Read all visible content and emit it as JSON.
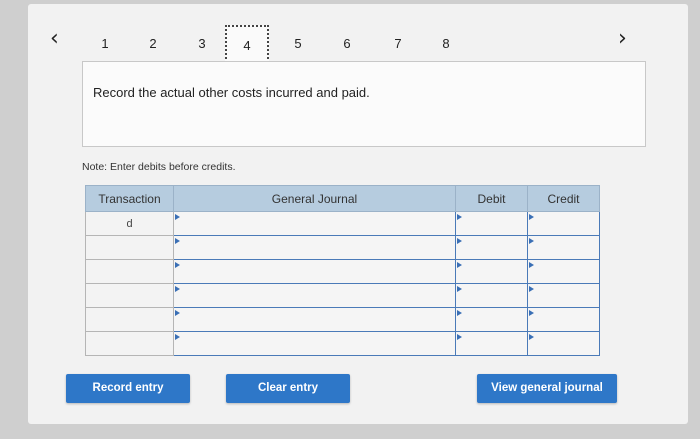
{
  "navigation": {
    "prev_icon": "chevron-left-icon",
    "next_icon": "chevron-right-icon",
    "steps": [
      "1",
      "2",
      "3",
      "4",
      "5",
      "6",
      "7",
      "8"
    ],
    "active_step": "4"
  },
  "question": {
    "prompt": "Record the actual other costs incurred and paid."
  },
  "note": "Note: Enter debits before credits.",
  "journal": {
    "headers": {
      "transaction": "Transaction",
      "general_journal": "General Journal",
      "debit": "Debit",
      "credit": "Credit"
    },
    "rows": [
      {
        "transaction": "d",
        "account": "",
        "debit": "",
        "credit": ""
      },
      {
        "transaction": "",
        "account": "",
        "debit": "",
        "credit": ""
      },
      {
        "transaction": "",
        "account": "",
        "debit": "",
        "credit": ""
      },
      {
        "transaction": "",
        "account": "",
        "debit": "",
        "credit": ""
      },
      {
        "transaction": "",
        "account": "",
        "debit": "",
        "credit": ""
      },
      {
        "transaction": "",
        "account": "",
        "debit": "",
        "credit": ""
      }
    ]
  },
  "buttons": {
    "record_entry": "Record entry",
    "clear_entry": "Clear entry",
    "view_general_journal": "View general journal"
  },
  "colors": {
    "button_bg": "#2e77c8",
    "header_bg": "#b6ccdf",
    "input_border": "#4a7ab8"
  }
}
